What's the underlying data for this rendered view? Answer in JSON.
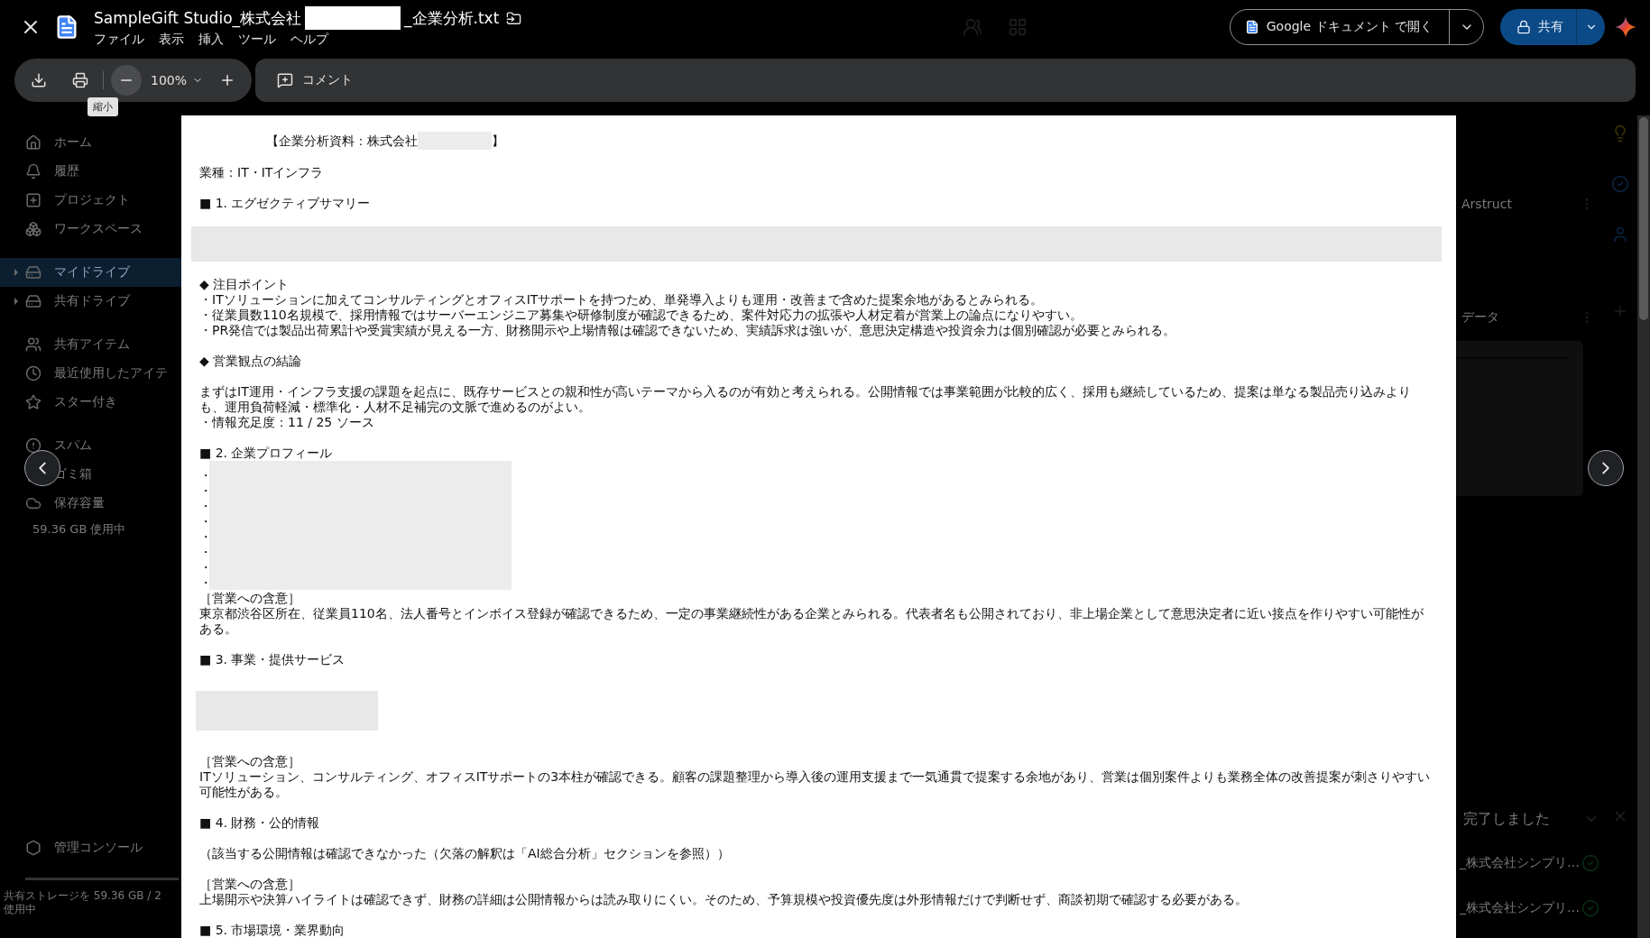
{
  "file": {
    "name_before": "SampleGift Studio_株式会社",
    "name_after": "_企業分析.txt"
  },
  "menu": [
    "ファイル",
    "表示",
    "挿入",
    "ツール",
    "ヘルプ"
  ],
  "open_button": {
    "label": "Google ドキュメント で開く"
  },
  "share_button": {
    "label": "共有"
  },
  "toolbar": {
    "zoom": "100%",
    "tooltip": "縮小",
    "comment": "コメント"
  },
  "sidebar": {
    "groups": [
      [
        {
          "label": "ホーム",
          "selected": false
        },
        {
          "label": "履歴",
          "selected": false
        },
        {
          "label": "プロジェクト",
          "selected": false
        },
        {
          "label": "ワークスペース",
          "selected": false
        }
      ],
      [
        {
          "label": "マイドライブ",
          "selected": true
        },
        {
          "label": "共有ドライブ",
          "selected": false
        }
      ],
      [
        {
          "label": "共有アイテム",
          "selected": false
        },
        {
          "label": "最近使用したアイテ",
          "selected": false
        },
        {
          "label": "スター付き",
          "selected": false
        }
      ],
      [
        {
          "label": "スパム",
          "selected": false
        },
        {
          "label": "ゴミ箱",
          "selected": false
        },
        {
          "label": "保存容量",
          "selected": false
        }
      ]
    ],
    "storage": "59.36 GB 使用中",
    "admin": "管理コンソール",
    "shared_storage": [
      "共有ストレージを 59.36 GB / 2",
      "使用中"
    ]
  },
  "right_panel": {
    "cards": [
      "Arstruct",
      "データ"
    ],
    "notice": "完了しました",
    "uploads": [
      {
        "name": "_株式会社シンプリ…",
        "done": true
      },
      {
        "name": "_株式会社シンプリ…",
        "done": true
      }
    ]
  },
  "document": {
    "blocks": [
      {
        "kind": "title",
        "before": "【企業分析資料：株式会社",
        "after": "】"
      },
      {
        "kind": "text",
        "lines": [
          "業種：IT・ITインフラ"
        ]
      },
      {
        "kind": "text",
        "lines": [
          "■ 1. エグゼクティブサマリー"
        ]
      },
      {
        "kind": "band"
      },
      {
        "kind": "text",
        "lines": [
          "◆ 注目ポイント",
          "・ITソリューションに加えてコンサルティングとオフィスITサポートを持つため、単発導入よりも運用・改善まで含めた提案余地があるとみられる。",
          "・従業員数110名規模で、採用情報ではサーバーエンジニア募集や研修制度が確認できるため、案件対応力の拡張や人材定着が営業上の論点になりやすい。",
          "・PR発信では製品出荷累計や受賞実績が見える一方、財務開示や上場情報は確認できないため、実績訴求は強いが、意思決定構造や投資余力は個別確認が必要とみられる。"
        ]
      },
      {
        "kind": "text",
        "lines": [
          "◆ 営業観点の結論"
        ]
      },
      {
        "kind": "text",
        "lines": [
          "まずはIT運用・インフラ支援の課題を起点に、既存サービスとの親和性が高いテーマから入るのが有効と考えられる。公開情報では事業範囲が比較的広く、採用も継続しているため、提案は単なる製品売り込みよりも、運用負荷軽減・標準化・人材不足補完の文脈で進めるのがよい。",
          "・情報充足度：11 / 25 ソース"
        ]
      },
      {
        "kind": "redacted_list",
        "heading": "■ 2. 企業プロフィール",
        "bullets": [
          "・",
          "・",
          "・",
          "・",
          "・",
          "・",
          "・",
          "・"
        ],
        "lines": [
          "［営業への含意］",
          "東京都渋谷区所在、従業員110名、法人番号とインボイス登録が確認できるため、一定の事業継続性がある企業とみられる。代表者名も公開されており、非上場企業として意思決定者に近い接点を作りやすい可能性がある。"
        ]
      },
      {
        "kind": "text",
        "lines": [
          "■ 3. 事業・提供サービス"
        ]
      },
      {
        "kind": "box"
      },
      {
        "kind": "text",
        "lines": [
          "［営業への含意］",
          "ITソリューション、コンサルティング、オフィスITサポートの3本柱が確認できる。顧客の課題整理から導入後の運用支援まで一気通貫で提案する余地があり、営業は個別案件よりも業務全体の改善提案が刺さりやすい可能性がある。"
        ]
      },
      {
        "kind": "text",
        "lines": [
          "■ 4. 財務・公的情報"
        ]
      },
      {
        "kind": "text",
        "lines": [
          "（該当する公開情報は確認できなかった（欠落の解釈は「AI総合分析」セクションを参照））"
        ]
      },
      {
        "kind": "text",
        "lines": [
          "［営業への含意］",
          "上場開示や決算ハイライトは確認できず、財務の詳細は公開情報からは読み取りにくい。そのため、予算規模や投資優先度は外形情報だけで判断せず、商談初期で確認する必要がある。"
        ]
      },
      {
        "kind": "text",
        "lines": [
          "■ 5. 市場環境・業界動向"
        ]
      }
    ]
  }
}
